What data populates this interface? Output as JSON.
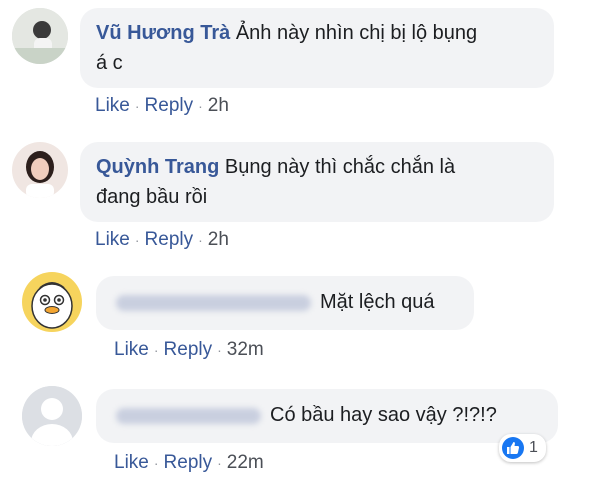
{
  "colors": {
    "link": "#385898",
    "bubble": "#f2f3f5",
    "text": "#1c1e21",
    "meta": "#4b4f56",
    "like_badge": "#1877f2"
  },
  "action_labels": {
    "like": "Like",
    "reply": "Reply"
  },
  "comments": [
    {
      "author": "Vũ Hương Trà",
      "text_line1": "Ảnh này nhìn chị bị lộ bụng",
      "text_line2": "á c",
      "time": "2h",
      "avatar_icon": "user-photo-avatar"
    },
    {
      "author": "Quỳnh Trang",
      "text_line1": "Bụng này thì chắc chắn là",
      "text_line2": "đang bầu rồi",
      "time": "2h",
      "avatar_icon": "user-photo-avatar"
    },
    {
      "author_hidden": true,
      "text": "Mặt lệch quá",
      "time": "32m",
      "avatar_icon": "cartoon-penguin-avatar"
    },
    {
      "author_hidden": true,
      "text": "Có bầu hay sao vậy ?!?!?",
      "time": "22m",
      "avatar_icon": "default-profile-avatar",
      "reaction": {
        "icon": "like-reaction-icon",
        "count": "1"
      }
    }
  ]
}
